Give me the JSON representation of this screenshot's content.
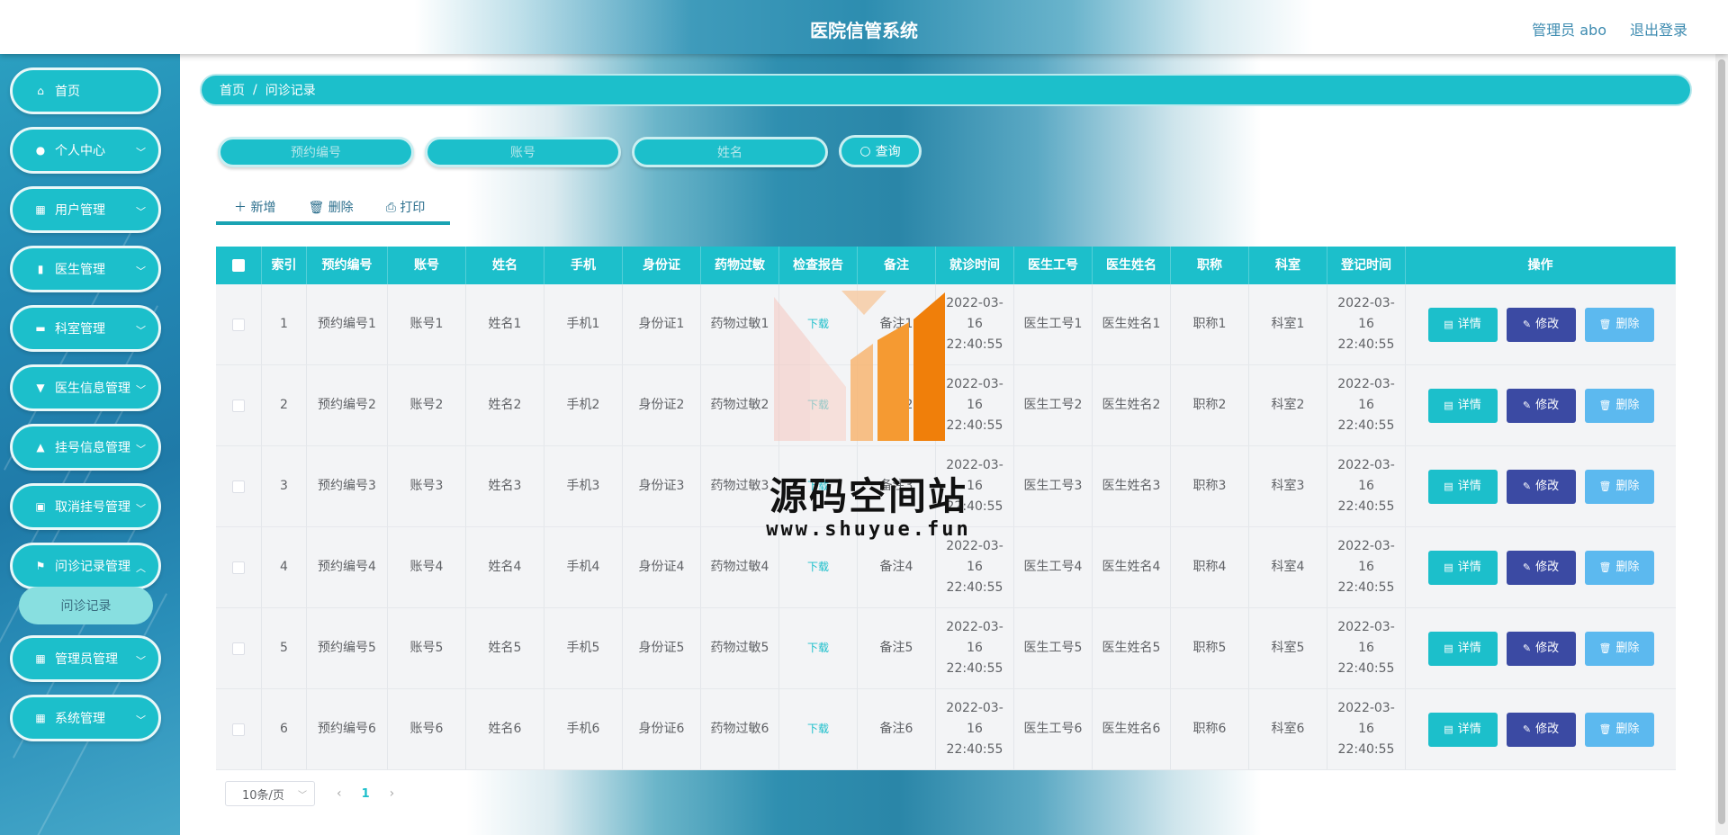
{
  "header": {
    "title": "医院信管系统",
    "user": "管理员 abo",
    "logout": "退出登录"
  },
  "sidebar": {
    "items": [
      {
        "label": "首页",
        "icon": "home-icon",
        "glyph": "⌂"
      },
      {
        "label": "个人中心",
        "icon": "user-icon",
        "glyph": "●"
      },
      {
        "label": "用户管理",
        "icon": "grid-icon",
        "glyph": "▦"
      },
      {
        "label": "医生管理",
        "icon": "building-icon",
        "glyph": "▮"
      },
      {
        "label": "科室管理",
        "icon": "ticket-icon",
        "glyph": "▬"
      },
      {
        "label": "医生信息管理",
        "icon": "notice-icon",
        "glyph": "▼"
      },
      {
        "label": "挂号信息管理",
        "icon": "person-icon",
        "glyph": "▲"
      },
      {
        "label": "取消挂号管理",
        "icon": "briefcase-icon",
        "glyph": "▣"
      },
      {
        "label": "问诊记录管理",
        "icon": "flag-icon",
        "glyph": "⚑"
      },
      {
        "label": "管理员管理",
        "icon": "grid-icon",
        "glyph": "▦"
      },
      {
        "label": "系统管理",
        "icon": "grid-icon",
        "glyph": "▦"
      }
    ],
    "submenu": "问诊记录"
  },
  "breadcrumb": {
    "home": "首页",
    "sep": "/",
    "current": "问诊记录"
  },
  "search": {
    "placeholder1": "预约编号",
    "placeholder2": "账号",
    "placeholder3": "姓名",
    "button": "查询"
  },
  "toolbar": {
    "add": "新增",
    "delete": "删除",
    "print": "打印"
  },
  "table": {
    "headers": [
      "索引",
      "预约编号",
      "账号",
      "姓名",
      "手机",
      "身份证",
      "药物过敏",
      "检查报告",
      "备注",
      "就诊时间",
      "医生工号",
      "医生姓名",
      "职称",
      "科室",
      "登记时间",
      "操作"
    ],
    "rows": [
      [
        "1",
        "预约编号1",
        "账号1",
        "姓名1",
        "手机1",
        "身份证1",
        "药物过敏1",
        "下载",
        "备注1",
        "2022-03-16 22:40:55",
        "医生工号1",
        "医生姓名1",
        "职称1",
        "科室1",
        "2022-03-16 22:40:55"
      ],
      [
        "2",
        "预约编号2",
        "账号2",
        "姓名2",
        "手机2",
        "身份证2",
        "药物过敏2",
        "下载",
        "备注2",
        "2022-03-16 22:40:55",
        "医生工号2",
        "医生姓名2",
        "职称2",
        "科室2",
        "2022-03-16 22:40:55"
      ],
      [
        "3",
        "预约编号3",
        "账号3",
        "姓名3",
        "手机3",
        "身份证3",
        "药物过敏3",
        "下载",
        "备注3",
        "2022-03-16 22:40:55",
        "医生工号3",
        "医生姓名3",
        "职称3",
        "科室3",
        "2022-03-16 22:40:55"
      ],
      [
        "4",
        "预约编号4",
        "账号4",
        "姓名4",
        "手机4",
        "身份证4",
        "药物过敏4",
        "下载",
        "备注4",
        "2022-03-16 22:40:55",
        "医生工号4",
        "医生姓名4",
        "职称4",
        "科室4",
        "2022-03-16 22:40:55"
      ],
      [
        "5",
        "预约编号5",
        "账号5",
        "姓名5",
        "手机5",
        "身份证5",
        "药物过敏5",
        "下载",
        "备注5",
        "2022-03-16 22:40:55",
        "医生工号5",
        "医生姓名5",
        "职称5",
        "科室5",
        "2022-03-16 22:40:55"
      ],
      [
        "6",
        "预约编号6",
        "账号6",
        "姓名6",
        "手机6",
        "身份证6",
        "药物过敏6",
        "下载",
        "备注6",
        "2022-03-16 22:40:55",
        "医生工号6",
        "医生姓名6",
        "职称6",
        "科室6",
        "2022-03-16 22:40:55"
      ]
    ],
    "actions": {
      "detail": "详情",
      "edit": "修改",
      "delete": "删除"
    }
  },
  "pagination": {
    "page_size": "10条/页",
    "current_page": "1",
    "prev": "‹",
    "next": "›"
  },
  "watermark": {
    "text": "源码空间站",
    "url": "www.shuyue.fun"
  },
  "colors": {
    "accent": "#1cbfcb",
    "edit": "#3b4aa3",
    "delete": "#5cb9ef"
  }
}
